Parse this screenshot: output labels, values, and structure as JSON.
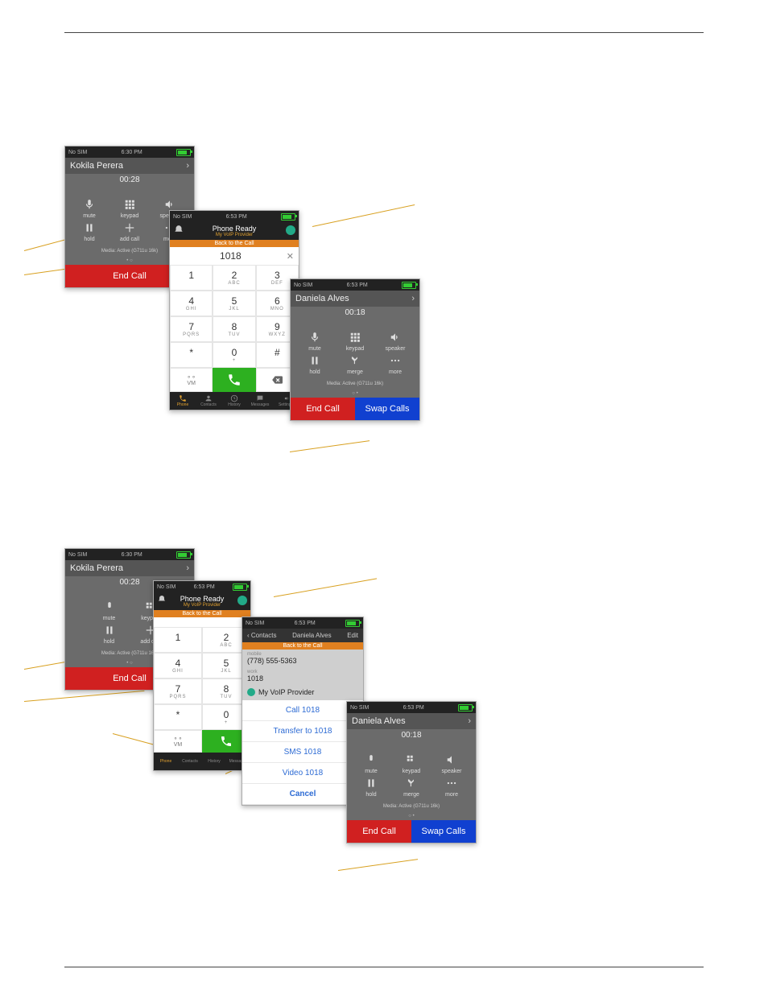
{
  "statusbar": {
    "left": "No SIM  ",
    "time1": "6:30 PM",
    "time2": "6:53 PM",
    "time3": "6:53 PM",
    "time4": "6:53 PM"
  },
  "call1": {
    "name": "Kokila Perera",
    "timer": "00:28",
    "btns": {
      "mute": "mute",
      "keypad": "keypad",
      "speaker": "speaker",
      "hold": "hold",
      "addcall": "add call",
      "more": "more"
    },
    "media": "Media: Active (G711u 16k)",
    "end": "End Call"
  },
  "call2": {
    "name": "Daniela Alves",
    "timer": "00:18",
    "btns": {
      "mute": "mute",
      "keypad": "keypad",
      "speaker": "speaker",
      "hold": "hold",
      "merge": "merge",
      "more": "more"
    },
    "media": "Media: Active (G711u 16k)",
    "end": "End Call",
    "swap": "Swap Calls"
  },
  "dialer": {
    "ready": "Phone Ready",
    "provider": "My VoIP Provider",
    "banner": "Back to the Call",
    "number": "1018",
    "keys": [
      {
        "d": "1",
        "s": ""
      },
      {
        "d": "2",
        "s": "ABC"
      },
      {
        "d": "3",
        "s": "DEF"
      },
      {
        "d": "4",
        "s": "GHI"
      },
      {
        "d": "5",
        "s": "JKL"
      },
      {
        "d": "6",
        "s": "MNO"
      },
      {
        "d": "7",
        "s": "PQRS"
      },
      {
        "d": "8",
        "s": "TUV"
      },
      {
        "d": "9",
        "s": "WXYZ"
      },
      {
        "d": "*",
        "s": ""
      },
      {
        "d": "0",
        "s": "+"
      },
      {
        "d": "#",
        "s": ""
      }
    ],
    "vm": "VM",
    "tabs": [
      "Phone",
      "Contacts",
      "History",
      "Messages",
      "Settings"
    ]
  },
  "dialer2": {
    "keys": [
      {
        "d": "1",
        "s": ""
      },
      {
        "d": "2",
        "s": "ABC"
      },
      {
        "d": "4",
        "s": "GHI"
      },
      {
        "d": "5",
        "s": "JKL"
      },
      {
        "d": "7",
        "s": "PQRS"
      },
      {
        "d": "8",
        "s": "TUV"
      },
      {
        "d": "*",
        "s": ""
      },
      {
        "d": "0",
        "s": "+"
      }
    ]
  },
  "contact": {
    "back": "Contacts",
    "title": "Daniela Alves",
    "edit": "Edit",
    "banner": "Back to the Call",
    "mobile_label": "mobile",
    "mobile": "(778) 555-5363",
    "work_label": "work",
    "work": "1018",
    "voip": "My VoIP Provider",
    "actions": {
      "call": "Call 1018",
      "transfer": "Transfer to 1018",
      "sms": "SMS 1018",
      "video": "Video 1018",
      "cancel": "Cancel"
    }
  }
}
